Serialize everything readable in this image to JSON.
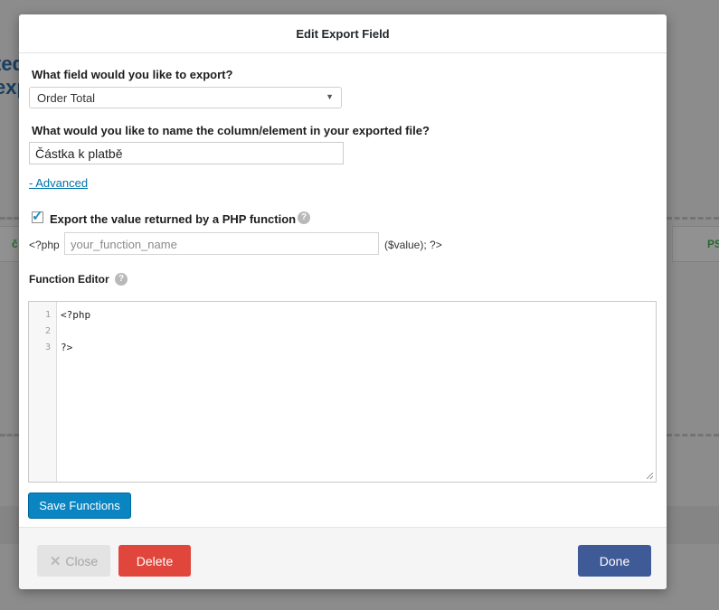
{
  "background": {
    "heading_line1": "ted",
    "heading_line2": "exp",
    "box_left_text": "č",
    "box_right_text": "PS"
  },
  "modal": {
    "title": "Edit Export Field",
    "field_question": "What field would you like to export?",
    "field_select": {
      "selected": "Order Total"
    },
    "column_question": "What would you like to name the column/element in your exported file?",
    "column_name_value": "Částka k platbě",
    "advanced_link": "- Advanced",
    "php_export": {
      "label": "Export the value returned by a PHP function",
      "checked": true,
      "prefix": "<?php",
      "function_placeholder": "your_function_name",
      "suffix": "($value); ?>"
    },
    "function_editor": {
      "label": "Function Editor",
      "lines": [
        {
          "number": "1",
          "code": "<?php"
        },
        {
          "number": "2",
          "code": ""
        },
        {
          "number": "3",
          "code": "?>"
        }
      ]
    },
    "save_functions_label": "Save Functions",
    "footer": {
      "close_label": "Close",
      "delete_label": "Delete",
      "done_label": "Done"
    }
  },
  "colors": {
    "primary_blue": "#0a85c2",
    "delete_red": "#e0463c",
    "done_navy": "#3f5b97",
    "link_blue": "#0073aa"
  },
  "icons": {
    "help": "help-icon",
    "dropdown": "chevron-down-icon",
    "checkmark": "checkmark-icon",
    "close": "close-icon"
  }
}
